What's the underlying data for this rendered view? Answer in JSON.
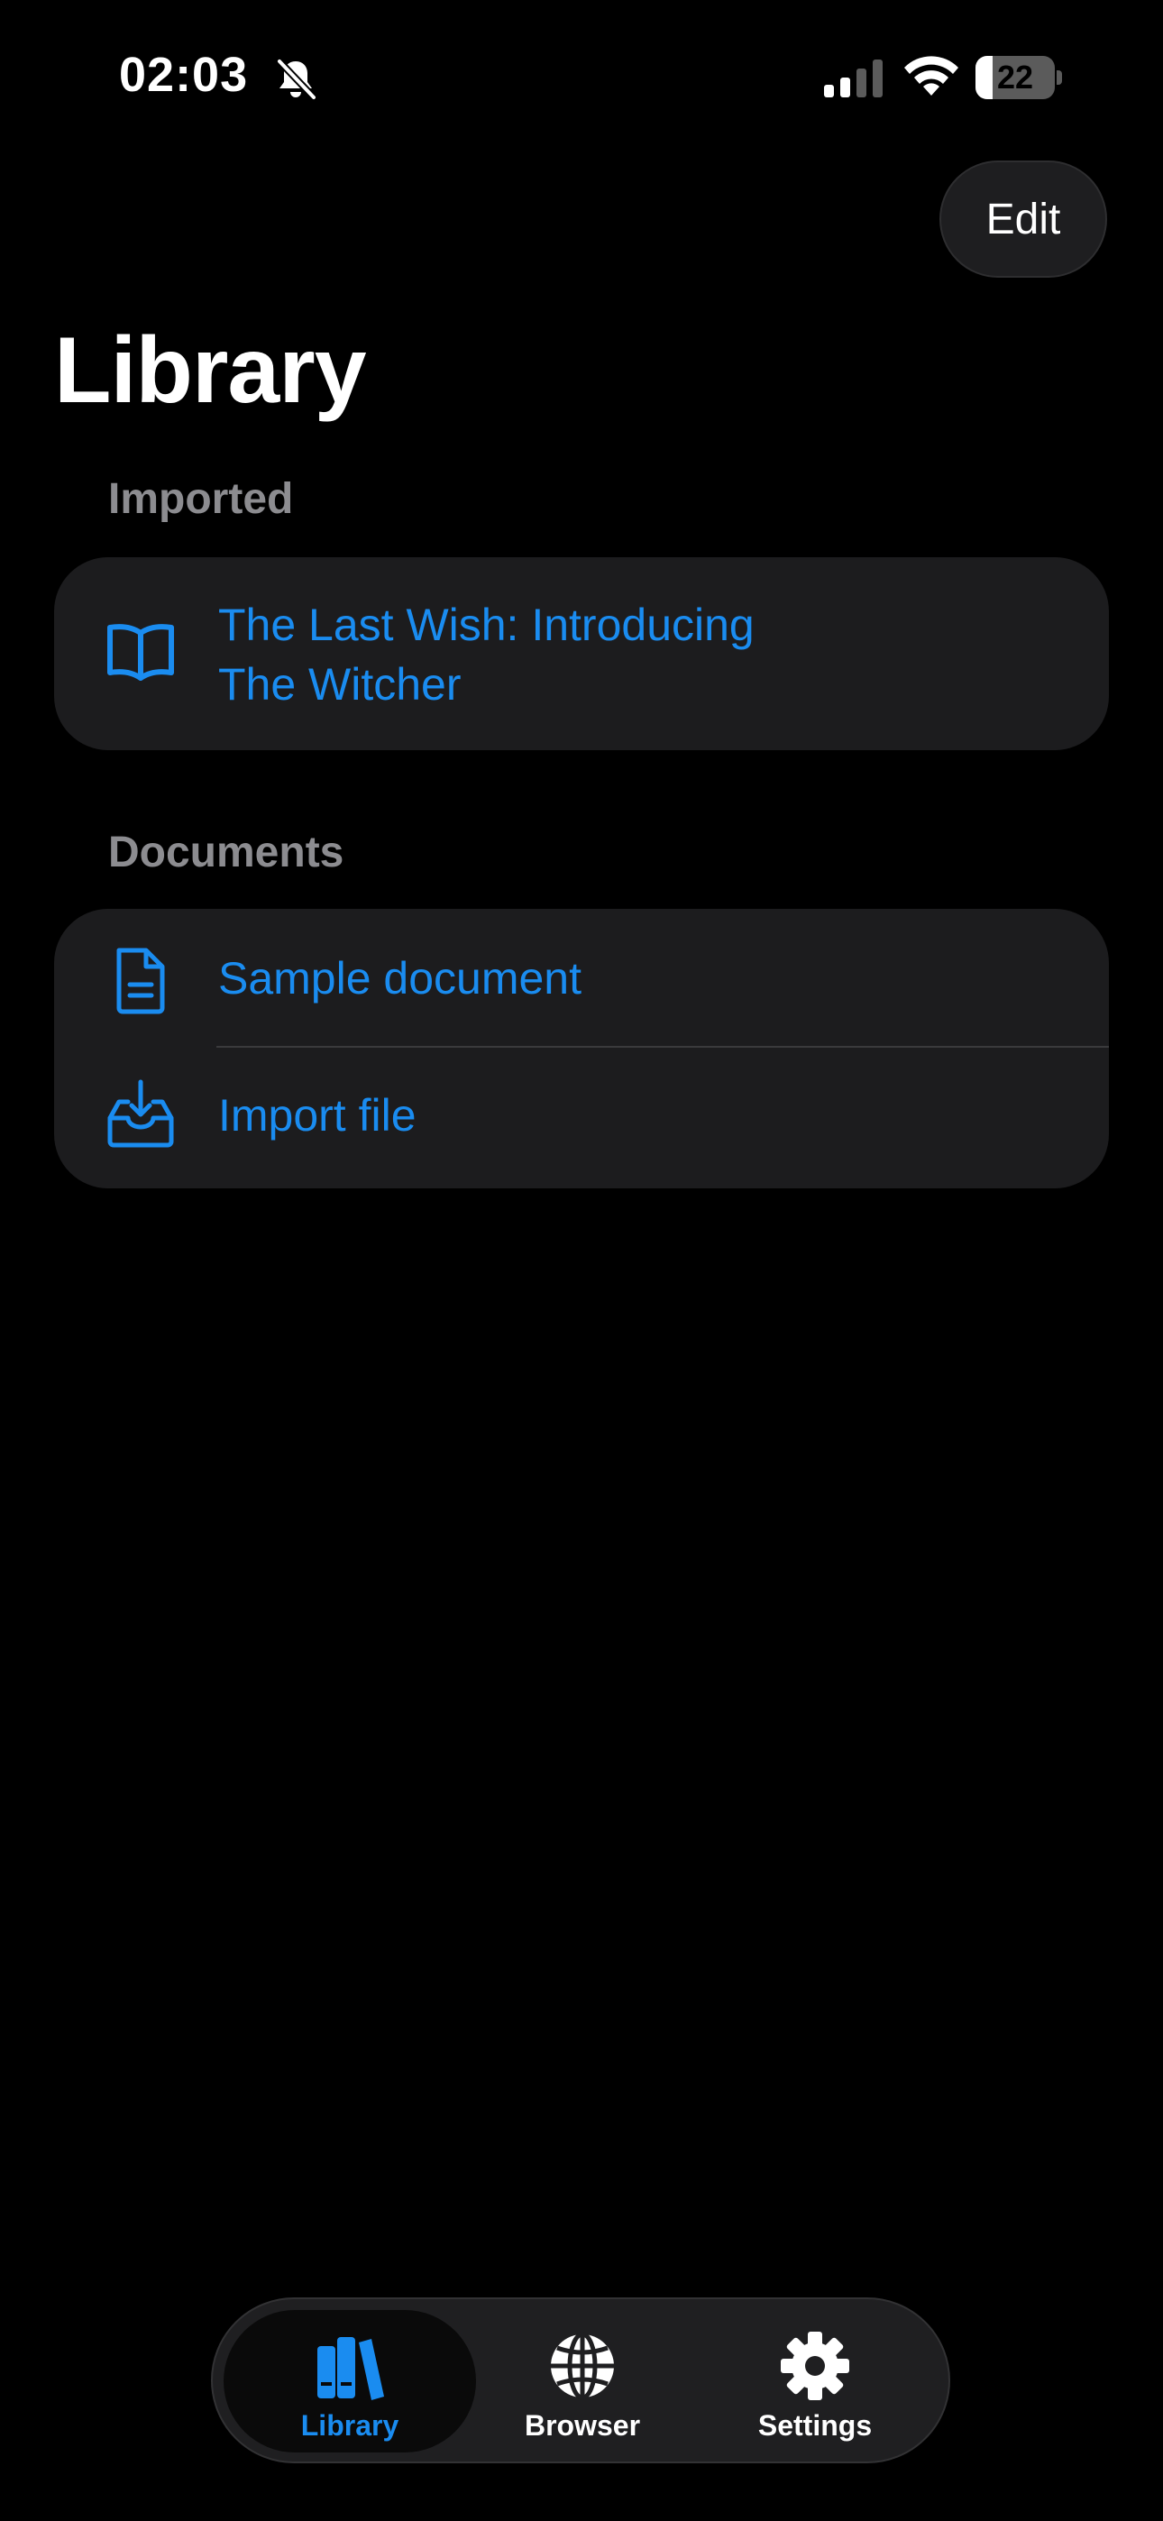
{
  "status_bar": {
    "time": "02:03",
    "battery_level": 22,
    "battery_text": "22",
    "icons": [
      "bell-slash-icon",
      "cellular-signal-icon",
      "wifi-icon",
      "battery-icon"
    ]
  },
  "header": {
    "edit_label": "Edit",
    "title": "Library"
  },
  "sections": {
    "imported": {
      "header": "Imported",
      "items": [
        {
          "icon": "book-open-icon",
          "label_line1": "The Last Wish: Introducing",
          "label_line2": "The Witcher"
        }
      ]
    },
    "documents": {
      "header": "Documents",
      "items": [
        {
          "icon": "document-icon",
          "label": "Sample document"
        },
        {
          "icon": "tray-download-icon",
          "label": "Import file"
        }
      ]
    }
  },
  "tab_bar": {
    "selected": "Library",
    "tabs": [
      {
        "label": "Library",
        "icon": "books-icon"
      },
      {
        "label": "Browser",
        "icon": "globe-icon"
      },
      {
        "label": "Settings",
        "icon": "gear-icon"
      }
    ]
  },
  "colors": {
    "accent": "#1a8cf0",
    "background": "#000000",
    "card": "#1c1c1e",
    "section_header": "#8c8c90"
  }
}
